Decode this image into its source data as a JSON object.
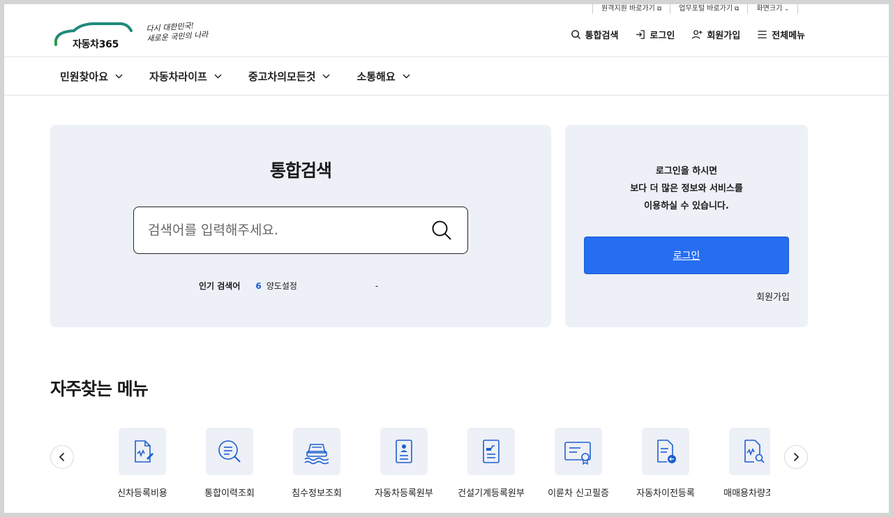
{
  "utility": {
    "remote_support": "원격지원 바로가기",
    "work_portal": "업무포털 바로가기",
    "font_size": "화면크기"
  },
  "header": {
    "logo_text": "자동차365",
    "slogan_line1": "다시 대한민국!",
    "slogan_line2": "새로운 국민의 나라",
    "util_items": [
      {
        "label": "통합검색",
        "icon": "search-icon"
      },
      {
        "label": "로그인",
        "icon": "login-icon"
      },
      {
        "label": "회원가입",
        "icon": "user-plus-icon"
      },
      {
        "label": "전체메뉴",
        "icon": "hamburger-icon"
      }
    ]
  },
  "nav": {
    "items": [
      "민원찾아요",
      "자동차라이프",
      "중고차의모든것",
      "소통해요"
    ]
  },
  "search": {
    "title": "통합검색",
    "placeholder": "검색어를 입력해주세요.",
    "popular_label": "인기 검색어",
    "popular_rank": "6",
    "popular_keyword": "양도설정",
    "popular_extra": "-"
  },
  "login": {
    "line1": "로그인을 하시면",
    "line2": "보다 더 많은 정보와 서비스를",
    "line3": "이용하실 수 있습니다.",
    "button": "로그인",
    "join": "회원가입"
  },
  "frequent": {
    "title": "자주찾는 메뉴",
    "items": [
      {
        "label": "신차등록비용",
        "icon": "document-sign-icon"
      },
      {
        "label": "통합이력조회",
        "icon": "search-document-icon"
      },
      {
        "label": "침수정보조회",
        "icon": "flooded-car-icon"
      },
      {
        "label": "자동차등록원부",
        "icon": "id-document-icon"
      },
      {
        "label": "건설기계등록원부",
        "icon": "construction-document-icon"
      },
      {
        "label": "이륜차 신고필증",
        "icon": "certificate-icon"
      },
      {
        "label": "자동차이전등록",
        "icon": "transfer-document-icon"
      },
      {
        "label": "매매용차량조회",
        "icon": "document-search-icon"
      }
    ]
  },
  "colors": {
    "primary": "#256ef1",
    "panel_bg": "#edf0f7",
    "icon_blue": "#1e5fcf",
    "logo_teal": "#1f8a7a"
  }
}
